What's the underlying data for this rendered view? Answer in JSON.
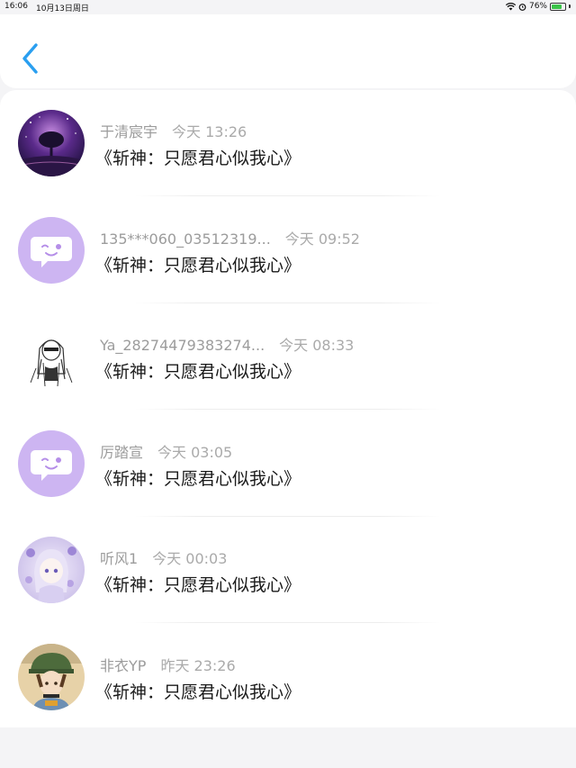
{
  "status_bar": {
    "time": "16:06",
    "date": "10月13日周日",
    "battery": "76%",
    "battery_level": 0.76
  },
  "header": {
    "back_icon": "chevron-left-icon",
    "accent_color": "#2a9ff0"
  },
  "messages": [
    {
      "username": "于清宸宇",
      "time": "今天 13:26",
      "text": "《斩神：只愿君心似我心》",
      "avatar": "night-galaxy-tree"
    },
    {
      "username": "135***060_03512319...",
      "time": "今天 09:52",
      "text": "《斩神：只愿君心似我心》",
      "avatar": "default-chat-bubble"
    },
    {
      "username": "Ya_28274479383274...",
      "time": "今天 08:33",
      "text": "《斩神：只愿君心似我心》",
      "avatar": "sketch-girl"
    },
    {
      "username": "厉踏宣",
      "time": "今天 03:05",
      "text": "《斩神：只愿君心似我心》",
      "avatar": "default-chat-bubble"
    },
    {
      "username": "听风1",
      "time": "今天 00:03",
      "text": "《斩神：只愿君心似我心》",
      "avatar": "anime-girl-lilac"
    },
    {
      "username": "非衣YP",
      "time": "昨天 23:26",
      "text": "《斩神：只愿君心似我心》",
      "avatar": "anime-boy-green-hat"
    }
  ]
}
